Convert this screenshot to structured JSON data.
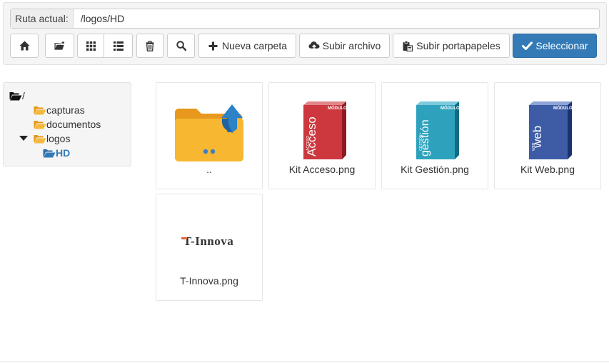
{
  "path_bar": {
    "label": "Ruta actual:",
    "value": "/logos/HD"
  },
  "toolbar": {
    "home_icon": "home-icon",
    "new_subfolder_icon": "folder-plus-icon",
    "grid_icon": "grid-icon",
    "list_icon": "list-icon",
    "delete_icon": "trash-icon",
    "search_icon": "search-icon",
    "new_folder_label": "Nueva carpeta",
    "upload_file_label": "Subir archivo",
    "upload_clipboard_label": "Subir portapapeles",
    "select_label": "Seleccionar"
  },
  "tree": {
    "root": "/",
    "items": [
      {
        "label": "capturas",
        "expanded": false
      },
      {
        "label": "documentos",
        "expanded": false
      },
      {
        "label": "logos",
        "expanded": true,
        "children": [
          {
            "label": "HD",
            "selected": true
          }
        ]
      }
    ]
  },
  "files": [
    {
      "name": "..",
      "type": "parent-folder"
    },
    {
      "name": "Kit Acceso.png",
      "type": "image",
      "box_text": "Acceso",
      "box_small": "ACCESO",
      "box_top": "MÓDULO",
      "color": "#c8282e"
    },
    {
      "name": "Kit Gestión.png",
      "type": "image",
      "box_text": "gestión",
      "box_small": "GESTIÓN",
      "box_top": "MÓDULO",
      "color": "#1d9bb8"
    },
    {
      "name": "Kit Web.png",
      "type": "image",
      "box_text": "web",
      "box_small": "WEB",
      "box_top": "MÓDULO",
      "color": "#2d4f9e"
    },
    {
      "name": "T-Innova.png",
      "type": "image",
      "logo_text": "T-Innova"
    }
  ],
  "colors": {
    "primary": "#337ab7",
    "folder": "#f0ad2a",
    "panel_bg": "#f5f5f5"
  }
}
